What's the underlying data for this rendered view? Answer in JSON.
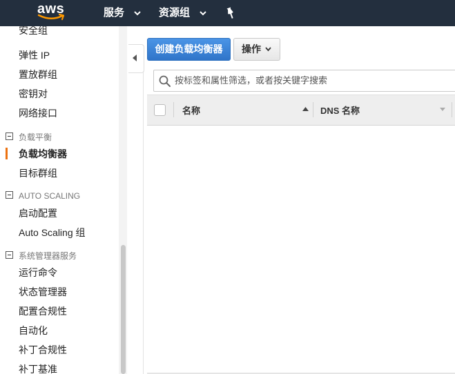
{
  "topbar": {
    "logo": "aws",
    "services_label": "服务",
    "resource_groups_label": "资源组",
    "pin_icon": "pushpin-icon"
  },
  "sidebar": {
    "cut_item": "安全组",
    "items_top": [
      "弹性 IP",
      "置放群组",
      "密钥对",
      "网络接口"
    ],
    "sections": [
      {
        "title": "负载平衡",
        "items": [
          "负载均衡器",
          "目标群组"
        ],
        "active": "负载均衡器"
      },
      {
        "title": "AUTO SCALING",
        "items": [
          "启动配置",
          "Auto Scaling 组"
        ]
      },
      {
        "title": "系统管理器服务",
        "items": [
          "运行命令",
          "状态管理器",
          "配置合规性",
          "自动化",
          "补丁合规性",
          "补丁基准"
        ]
      }
    ]
  },
  "toolbar": {
    "create_label": "创建负载均衡器",
    "actions_label": "操作"
  },
  "search": {
    "placeholder": "按标签和属性筛选，或者按关键字搜索"
  },
  "table": {
    "columns": [
      "名称",
      "DNS 名称"
    ]
  },
  "colors": {
    "topbar": "#232f3e",
    "primary_button": "#2f74c9",
    "active_indicator": "#ec7211"
  }
}
